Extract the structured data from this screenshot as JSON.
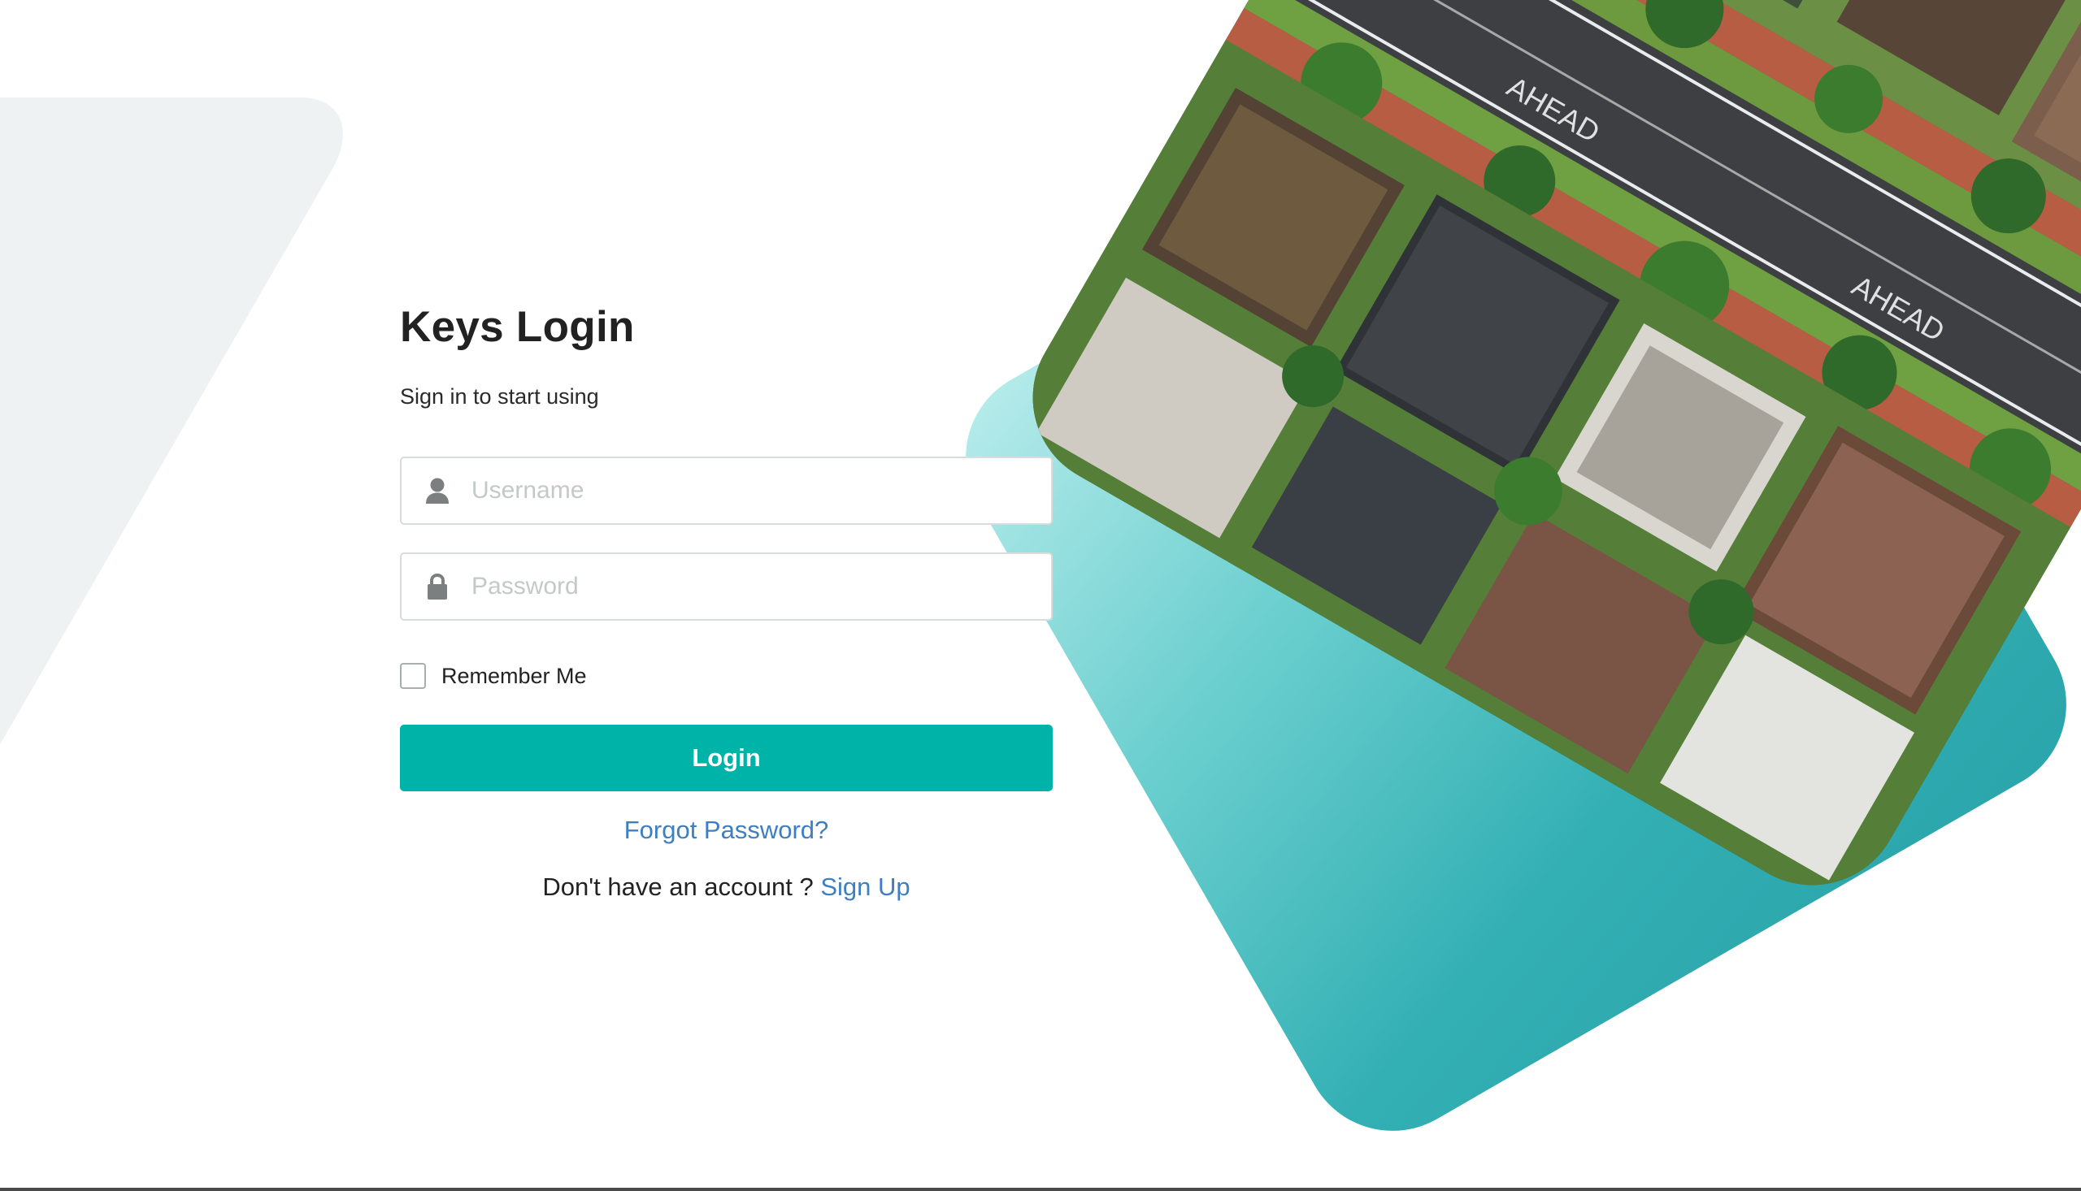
{
  "login": {
    "title": "Keys Login",
    "subtitle": "Sign in to start using",
    "username_placeholder": "Username",
    "password_placeholder": "Password",
    "remember_label": "Remember Me",
    "login_label": "Login",
    "forgot_label": "Forgot Password?",
    "signup_prompt": "Don't have an account ? ",
    "signup_label": "Sign Up"
  },
  "colors": {
    "accent": "#00b3a8",
    "link": "#3d7fc1",
    "teal_shape": "#2aa5ab",
    "left_shape": "#eef2f2"
  },
  "icons": {
    "username": "user-icon",
    "password": "lock-icon"
  }
}
